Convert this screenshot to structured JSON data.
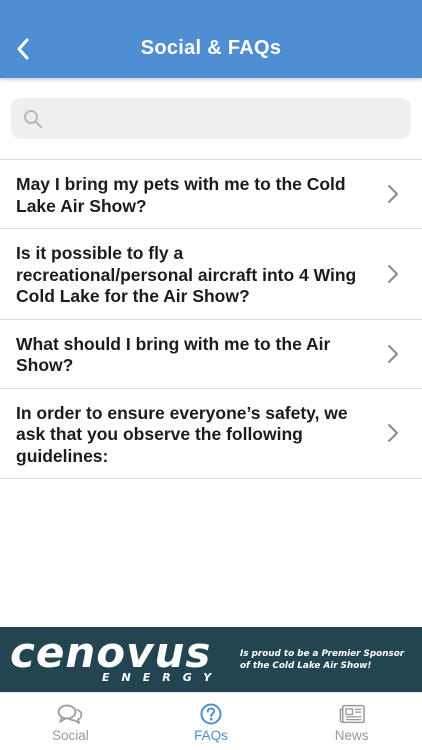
{
  "header": {
    "title": "Social & FAQs",
    "back_icon": "chevron-left-icon"
  },
  "search": {
    "placeholder": "",
    "value": "",
    "icon": "search-icon"
  },
  "faqs": [
    {
      "question": "May I bring my pets with me to the Cold Lake Air Show?"
    },
    {
      "question": "Is it possible to fly a recreational/personal aircraft into 4 Wing Cold Lake for the Air Show?"
    },
    {
      "question": "What should I bring with me to the Air Show?"
    },
    {
      "question": "In order to ensure everyone’s safety, we ask that you observe the following guidelines:"
    }
  ],
  "banner": {
    "brand": "cenovus",
    "brand_sub": "ENERGY",
    "sponsor_line1": "Is proud to be a Premier Sponsor",
    "sponsor_line2": "of the Cold Lake Air Show!"
  },
  "tabs": [
    {
      "label": "Social",
      "icon": "chat-bubbles-icon",
      "active": false
    },
    {
      "label": "FAQs",
      "icon": "question-circle-icon",
      "active": true
    },
    {
      "label": "News",
      "icon": "newspaper-icon",
      "active": false
    }
  ],
  "colors": {
    "header_bg": "#4f8ed2",
    "accent": "#4f8ed2",
    "banner_bg": "#234552",
    "inactive_tab": "#9a9a9a"
  }
}
